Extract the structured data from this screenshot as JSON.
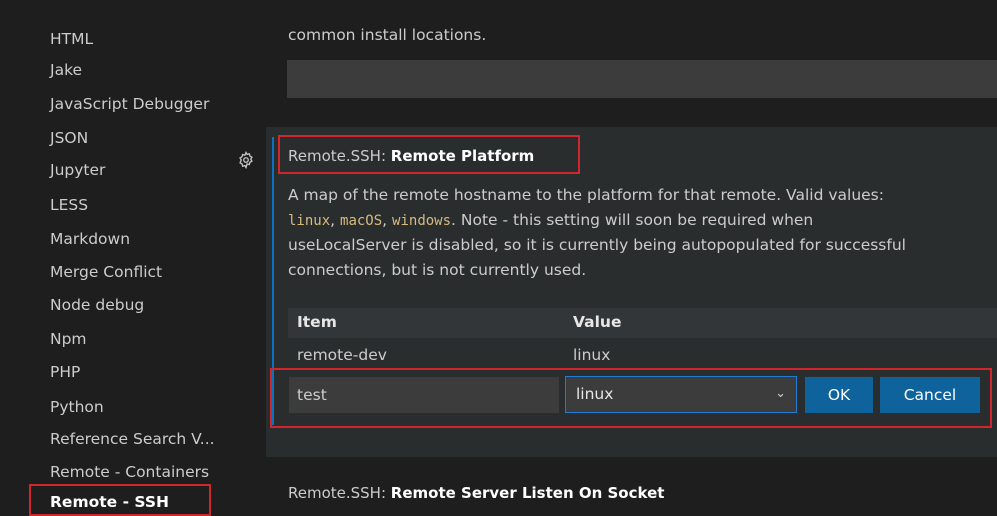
{
  "sidebar": {
    "items": [
      {
        "label": "HTML",
        "active": false
      },
      {
        "label": "Jake",
        "active": false
      },
      {
        "label": "JavaScript Debugger",
        "active": false
      },
      {
        "label": "JSON",
        "active": false
      },
      {
        "label": "Jupyter",
        "active": false
      },
      {
        "label": "LESS",
        "active": false
      },
      {
        "label": "Markdown",
        "active": false
      },
      {
        "label": "Merge Conflict",
        "active": false
      },
      {
        "label": "Node debug",
        "active": false
      },
      {
        "label": "Npm",
        "active": false
      },
      {
        "label": "PHP",
        "active": false
      },
      {
        "label": "Python",
        "active": false
      },
      {
        "label": "Reference Search V...",
        "active": false
      },
      {
        "label": "Remote - Containers",
        "active": false
      },
      {
        "label": "Remote - SSH",
        "active": true
      }
    ]
  },
  "previous_setting": {
    "description_tail": "common install locations."
  },
  "setting": {
    "icon": "gear-icon",
    "category": "Remote.SSH: ",
    "name": "Remote Platform",
    "desc_line1": "A map of the remote hostname to the platform for that remote. Valid values:",
    "value_linux": "linux",
    "value_macos": "macOS",
    "value_windows": "windows",
    "desc_line2_tail": ". Note - this setting will soon be required when",
    "desc_line3": "useLocalServer is disabled, so it is currently being autopopulated for successful",
    "desc_line4": "connections, but is not currently used.",
    "table": {
      "col_item": "Item",
      "col_value": "Value",
      "rows": [
        {
          "item": "remote-dev",
          "value": "linux"
        }
      ]
    },
    "edit_row": {
      "key_value": "test",
      "selected_value": "linux",
      "ok_label": "OK",
      "cancel_label": "Cancel"
    }
  },
  "next_setting": {
    "category": "Remote.SSH: ",
    "name": "Remote Server Listen On Socket"
  },
  "colors": {
    "accent": "#0e70c0",
    "highlight_box": "#d1262b",
    "button": "#0e639c"
  }
}
